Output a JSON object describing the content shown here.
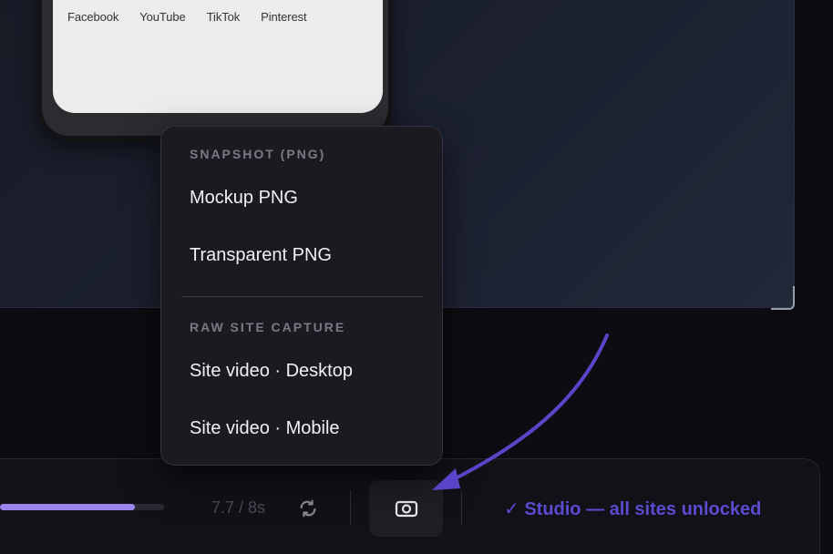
{
  "phone": {
    "social_links": [
      "Facebook",
      "YouTube",
      "TikTok",
      "Pinterest"
    ]
  },
  "player": {
    "progress": 0.82,
    "time_readout": "7.7 / 8s",
    "studio_badge": "✓ Studio — all sites unlocked"
  },
  "snapshot_menu": {
    "sections": [
      {
        "title": "SNAPSHOT (PNG)",
        "items": [
          "Mockup PNG",
          "Transparent PNG"
        ]
      },
      {
        "title": "RAW SITE CAPTURE",
        "items": [
          "Site video · Desktop",
          "Site video · Mobile"
        ]
      }
    ]
  },
  "colors": {
    "accent": "#9b86f0",
    "studio_badge": "#5a4bd0",
    "arrow": "#5a45c8"
  },
  "icons": {
    "loop": "loop-icon",
    "snapshot": "camera-icon"
  }
}
